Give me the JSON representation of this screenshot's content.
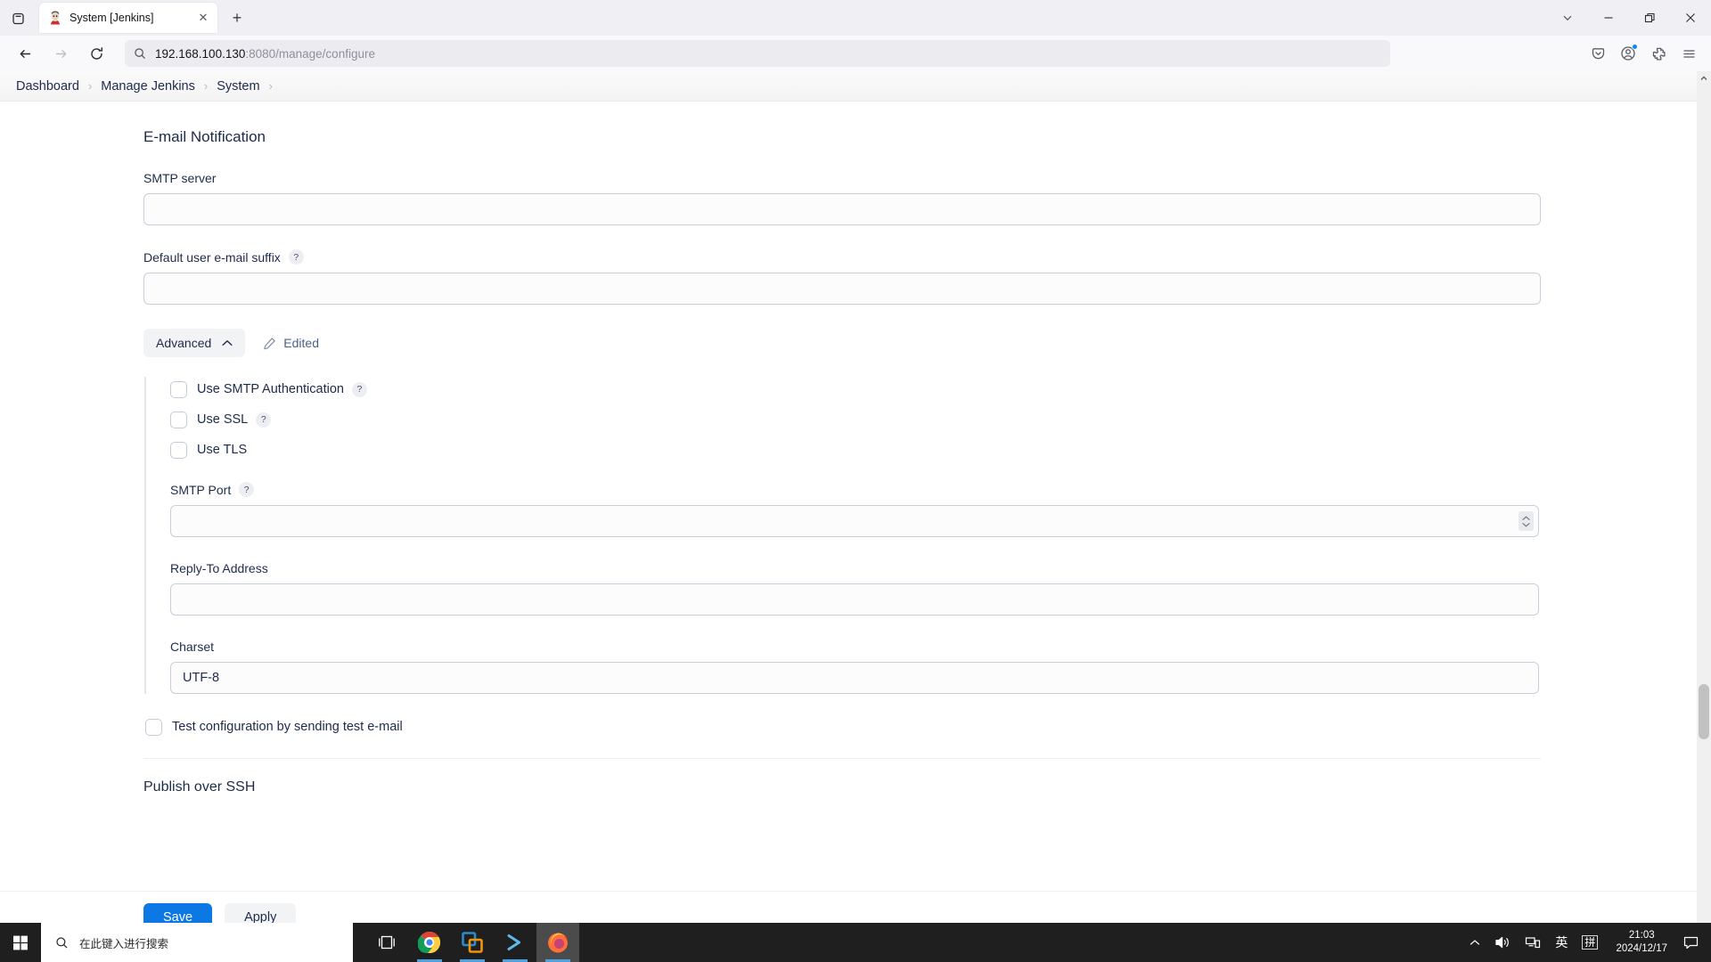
{
  "browser": {
    "tab": {
      "title": "System [Jenkins]",
      "favicon": "jenkins-favicon",
      "close_label": "✕"
    },
    "new_tab_label": "+",
    "url": {
      "host": "192.168.100.130",
      "path": ":8080/manage/configure"
    },
    "nav": {
      "back": "←",
      "forward": "→",
      "reload": "↻"
    },
    "window": {
      "minimize": "—",
      "restore": "❐",
      "close": "✕"
    }
  },
  "breadcrumb": [
    {
      "label": "Dashboard"
    },
    {
      "label": "Manage Jenkins"
    },
    {
      "label": "System"
    }
  ],
  "breadcrumb_separator": "›",
  "page": {
    "section_title": "E-mail Notification",
    "fields": {
      "smtp_server": {
        "label": "SMTP server",
        "value": "",
        "placeholder": ""
      },
      "default_suffix": {
        "label": "Default user e-mail suffix",
        "value": "",
        "placeholder": "",
        "help": "?"
      }
    },
    "advanced": {
      "button_label": "Advanced",
      "chevron": "⌃",
      "edited_label": "Edited",
      "checkboxes": [
        {
          "label": "Use SMTP Authentication",
          "help": "?",
          "checked": false
        },
        {
          "label": "Use SSL",
          "help": "?",
          "checked": false
        },
        {
          "label": "Use TLS",
          "help": "",
          "checked": false
        }
      ],
      "smtp_port": {
        "label": "SMTP Port",
        "help": "?",
        "value": "",
        "placeholder": ""
      },
      "reply_to": {
        "label": "Reply-To Address",
        "value": "",
        "placeholder": ""
      },
      "charset": {
        "label": "Charset",
        "value": "UTF-8",
        "placeholder": ""
      }
    },
    "test_config": {
      "label": "Test configuration by sending test e-mail",
      "checked": false
    },
    "publish_over_ssh_title": "Publish over SSH",
    "buttons": {
      "save": "Save",
      "apply": "Apply"
    }
  },
  "taskbar": {
    "search_placeholder": "在此键入进行搜索",
    "apps": [
      {
        "name": "task-view"
      },
      {
        "name": "google-chrome"
      },
      {
        "name": "vmware-workstation"
      },
      {
        "name": "windows-terminal"
      },
      {
        "name": "firefox"
      }
    ],
    "tray": {
      "chevron": "∧",
      "ime_language": "英",
      "ime_mode": "拼",
      "time": "21:03",
      "date": "2024/12/17"
    }
  },
  "colors": {
    "accent": "#0b78e3",
    "link": "#4c6286",
    "text": "#1d2b4b",
    "taskbar_bg": "#1f1f1f"
  }
}
